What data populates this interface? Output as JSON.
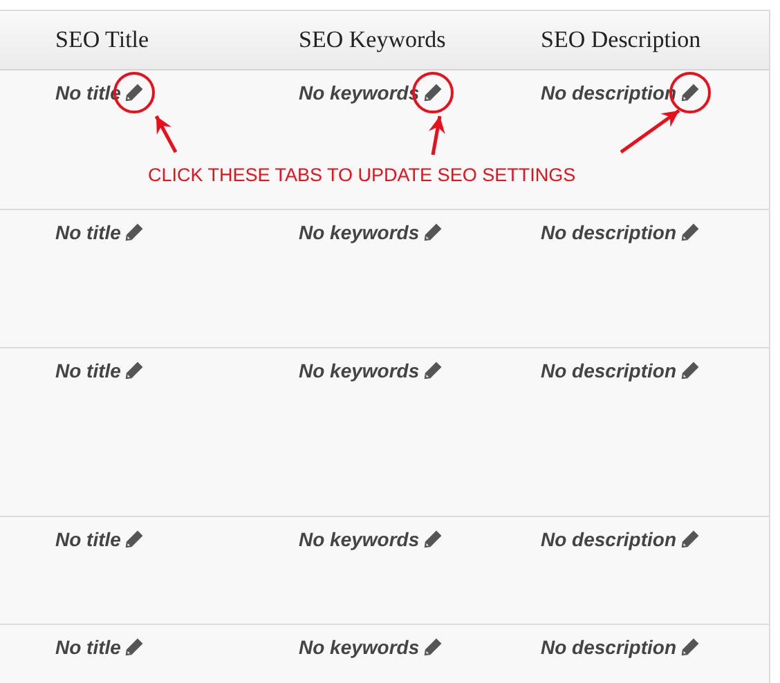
{
  "table": {
    "columns": [
      "SEO Title",
      "SEO Keywords",
      "SEO Description"
    ],
    "rows": [
      {
        "cells": [
          {
            "text": "No title",
            "highlighted": true
          },
          {
            "text": "No keywords",
            "highlighted": true
          },
          {
            "text": "No description",
            "highlighted": true
          }
        ]
      },
      {
        "cells": [
          {
            "text": "No title",
            "highlighted": false
          },
          {
            "text": "No keywords",
            "highlighted": false
          },
          {
            "text": "No description",
            "highlighted": false
          }
        ]
      },
      {
        "cells": [
          {
            "text": "No title",
            "highlighted": false
          },
          {
            "text": "No keywords",
            "highlighted": false
          },
          {
            "text": "No description",
            "highlighted": false
          }
        ]
      },
      {
        "cells": [
          {
            "text": "No title",
            "highlighted": false
          },
          {
            "text": "No keywords",
            "highlighted": false
          },
          {
            "text": "No description",
            "highlighted": false
          }
        ]
      },
      {
        "cells": [
          {
            "text": "No title",
            "highlighted": false
          },
          {
            "text": "No keywords",
            "highlighted": false
          },
          {
            "text": "No description",
            "highlighted": false
          }
        ]
      }
    ]
  },
  "annotation": {
    "caption": "CLICK THESE TABS TO UPDATE SEO SETTINGS"
  }
}
